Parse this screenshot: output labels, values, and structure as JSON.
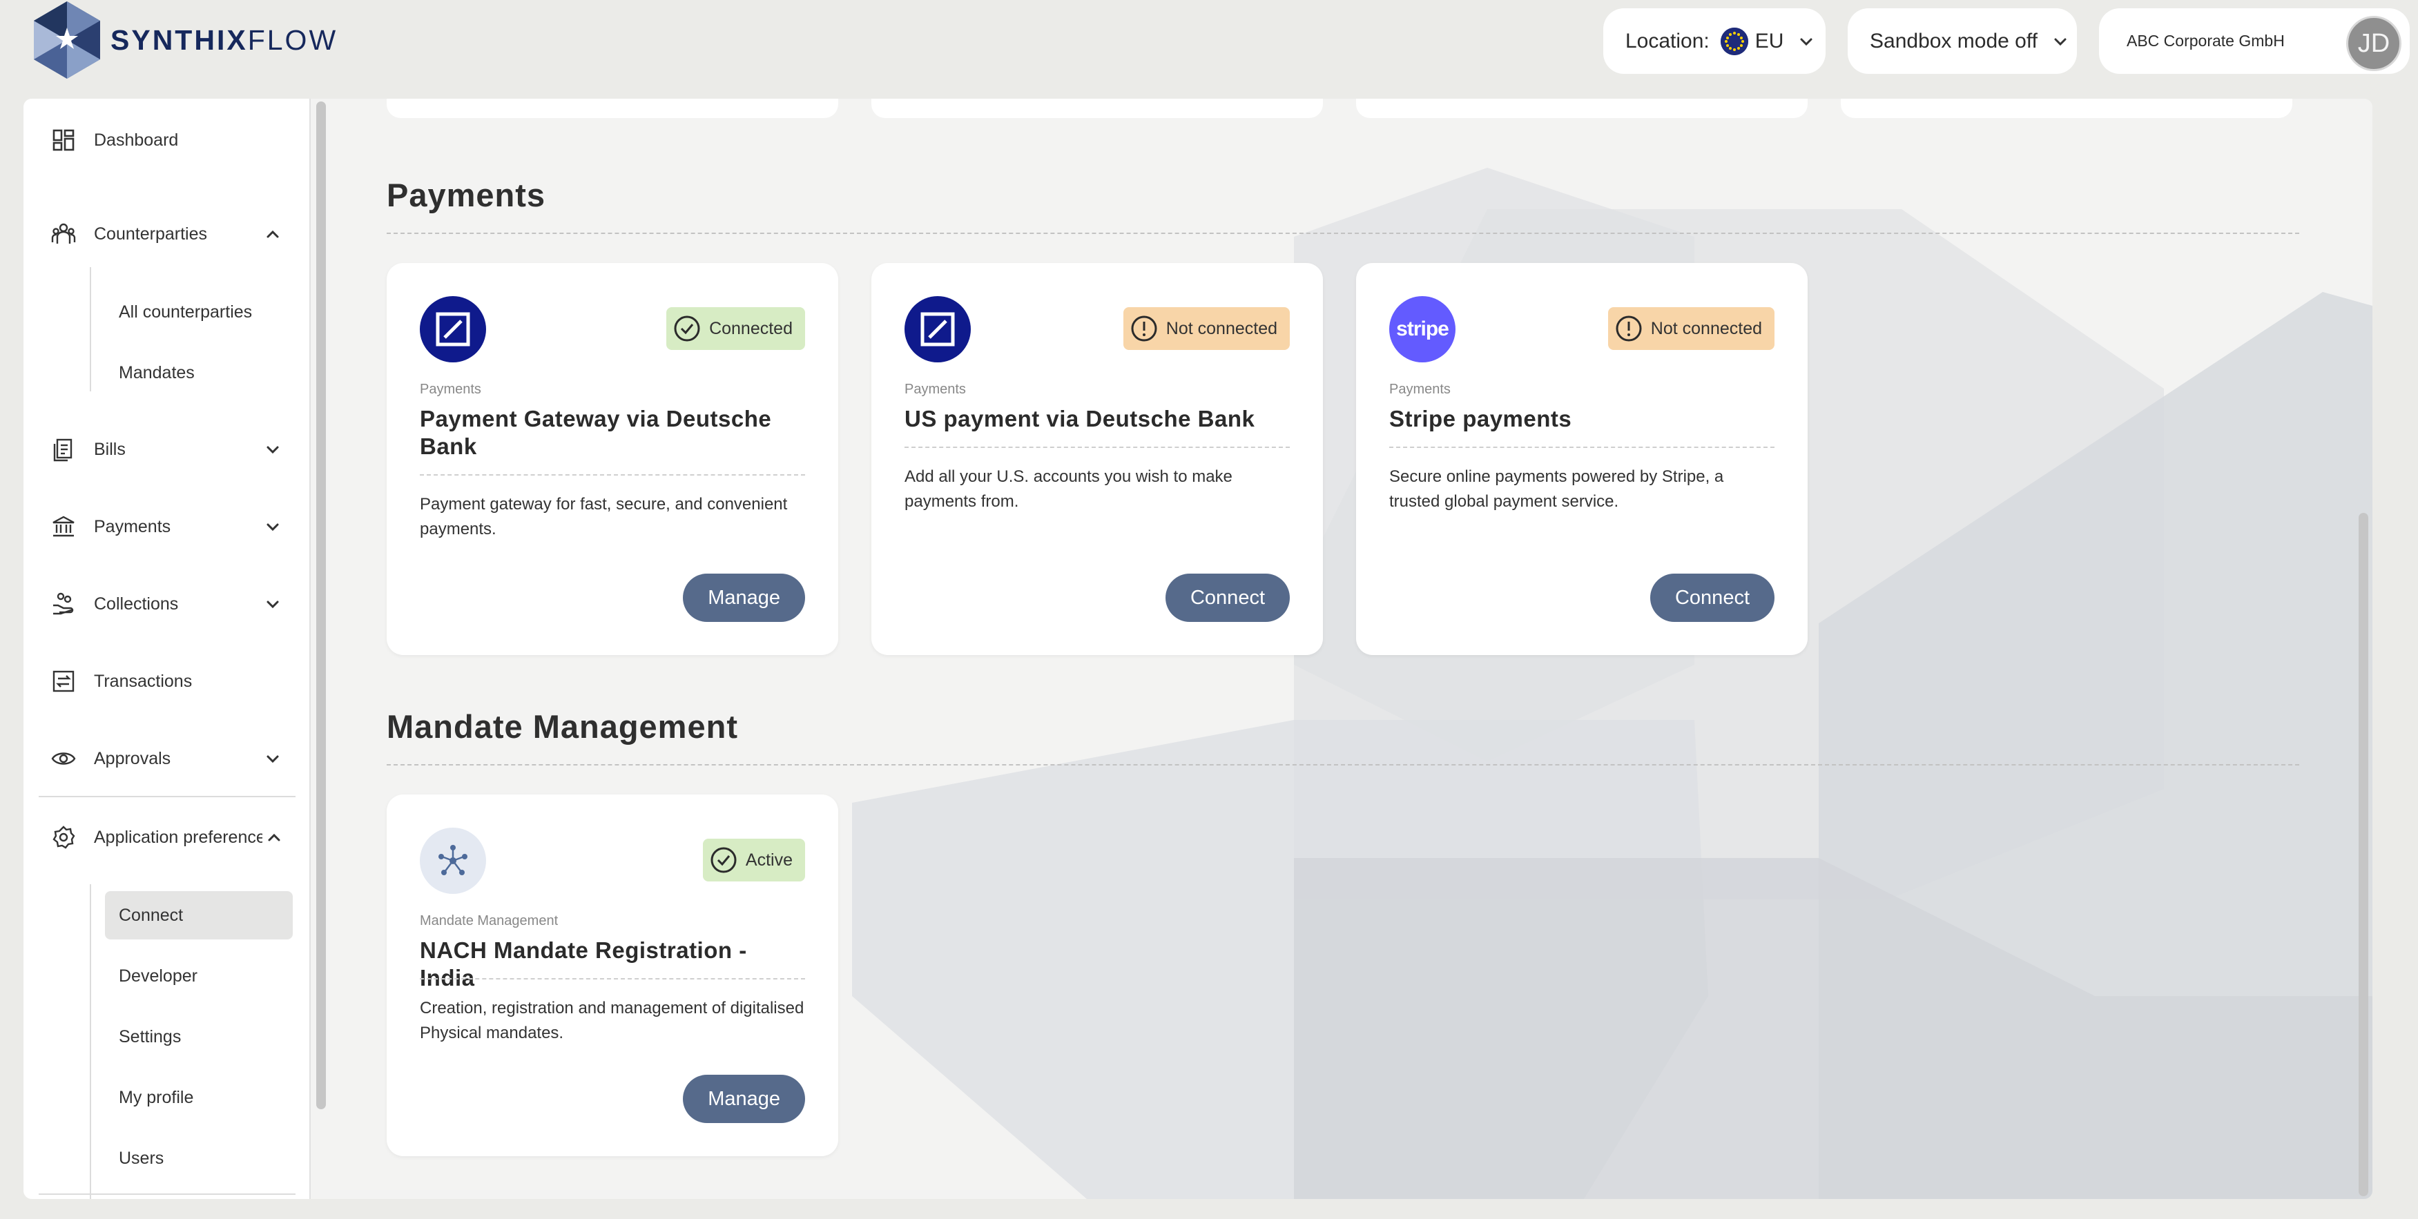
{
  "brand": {
    "name_bold": "SYNTHIX",
    "name_light": "FLOW"
  },
  "header": {
    "location_label": "Location:",
    "location_value": "EU",
    "sandbox_label": "Sandbox mode off",
    "company": "ABC Corporate GmbH",
    "avatar_initials": "JD"
  },
  "sidebar": {
    "dashboard": "Dashboard",
    "counterparties": "Counterparties",
    "all_counterparties": "All counterparties",
    "mandates": "Mandates",
    "bills": "Bills",
    "payments": "Payments",
    "collections": "Collections",
    "transactions": "Transactions",
    "approvals": "Approvals",
    "app_prefs": "Application preferences",
    "connect": "Connect",
    "developer": "Developer",
    "settings": "Settings",
    "my_profile": "My profile",
    "users": "Users"
  },
  "sections": {
    "payments_title": "Payments",
    "mandate_title": "Mandate Management"
  },
  "cards": [
    {
      "category": "Payments",
      "title": "Payment Gateway via Deutsche Bank",
      "status": "Connected",
      "description": "Payment gateway for fast, secure, and convenient payments.",
      "button": "Manage"
    },
    {
      "category": "Payments",
      "title": "US payment via Deutsche Bank",
      "status": "Not connected",
      "description": "Add all your U.S. accounts you wish to make payments from.",
      "button": "Connect"
    },
    {
      "category": "Payments",
      "title": "Stripe payments",
      "status": "Not connected",
      "logo_text": "stripe",
      "description": "Secure online payments powered by Stripe, a trusted global payment service.",
      "button": "Connect"
    },
    {
      "category": "Mandate Management",
      "title": "NACH Mandate Registration - India",
      "status": "Active",
      "description": "Creation, registration and management of digitalised Physical mandates.",
      "button": "Manage"
    }
  ],
  "colors": {
    "brand_navy": "#16285c",
    "button": "#566a8b",
    "badge_ok": "#d7ecc4",
    "badge_warn": "#f8d5a8",
    "deutsche_blue": "#0f1a8c",
    "stripe_purple": "#635bff"
  },
  "icons": {
    "dashboard": "dashboard-icon",
    "counterparties": "people-icon",
    "bills": "document-icon",
    "payments": "bank-icon",
    "collections": "hand-coins-icon",
    "transactions": "transfer-icon",
    "approvals": "eye-icon",
    "app_prefs": "gear-icon"
  }
}
